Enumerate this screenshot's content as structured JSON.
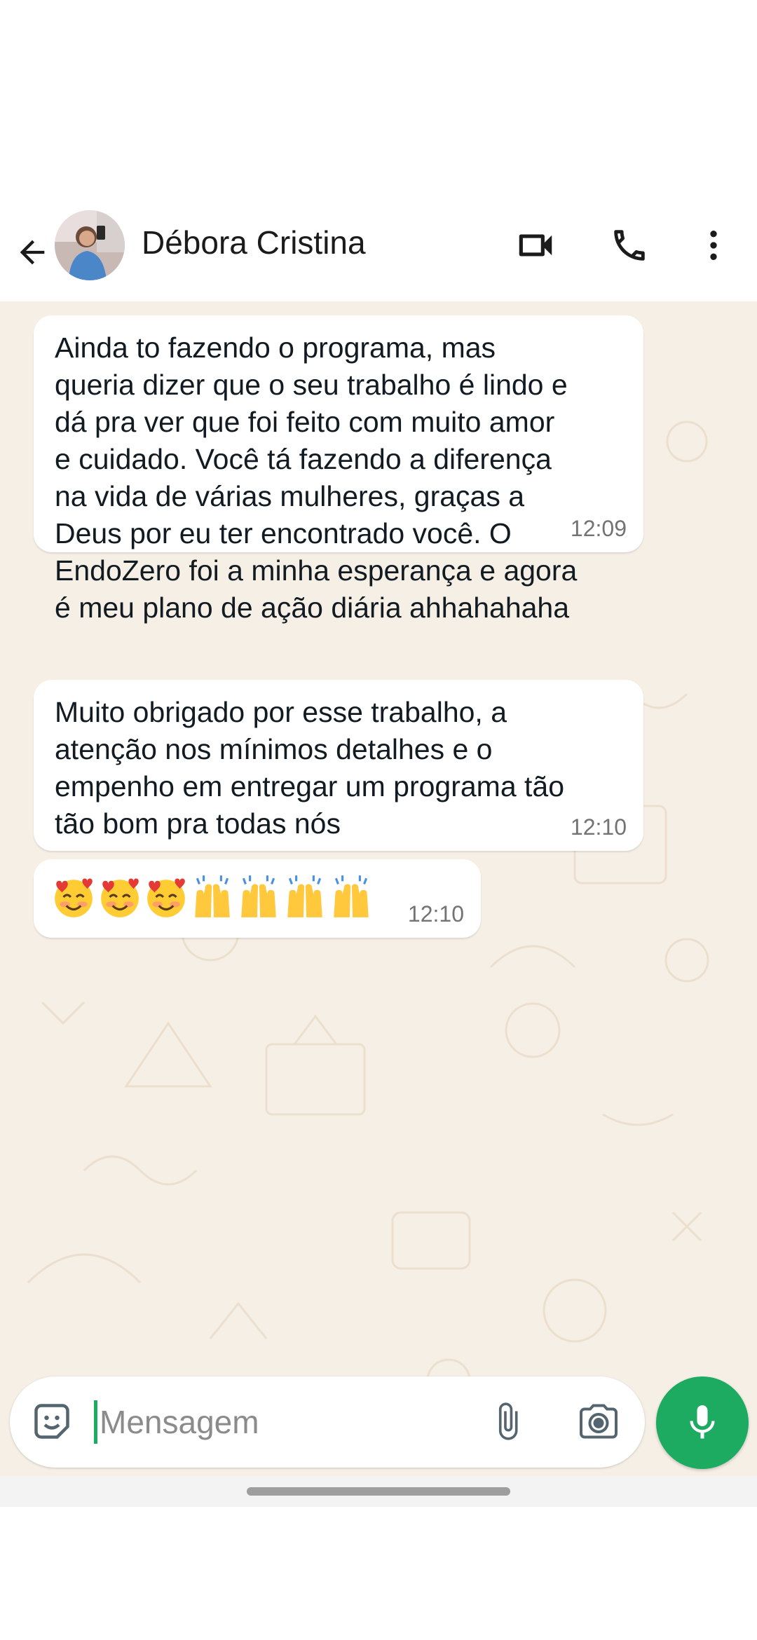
{
  "header": {
    "contact_name": "Débora Cristina",
    "icons": [
      "back-arrow-icon",
      "video-call-icon",
      "phone-icon",
      "more-vert-icon"
    ]
  },
  "messages": [
    {
      "text": "Ainda to fazendo o programa, mas\nqueria dizer que o seu trabalho é lindo e\ndá pra ver que foi feito com muito amor\ne cuidado. Você tá fazendo a diferença\nna vida de várias mulheres, graças a\nDeus por eu ter encontrado você. O\nEndoZero foi a minha esperança e agora\né meu plano de ação diária ahhahahaha",
      "time": "12:09"
    },
    {
      "text": "Muito obrigado por esse trabalho, a\natenção nos mínimos detalhes e o\nempenho em entregar um programa tão\ntão bom pra todas nós",
      "time": "12:10"
    },
    {
      "emojis": [
        "smiling-face-with-hearts",
        "smiling-face-with-hearts",
        "smiling-face-with-hearts",
        "raising-hands",
        "raising-hands",
        "raising-hands",
        "raising-hands"
      ],
      "time": "12:10"
    }
  ],
  "composer": {
    "placeholder": "Mensagem",
    "icons": [
      "sticker-icon",
      "attach-icon",
      "camera-icon",
      "mic-icon"
    ]
  },
  "colors": {
    "chat_background": "#f6efe6",
    "bubble": "#ffffff",
    "accent_green": "#1daa61"
  }
}
